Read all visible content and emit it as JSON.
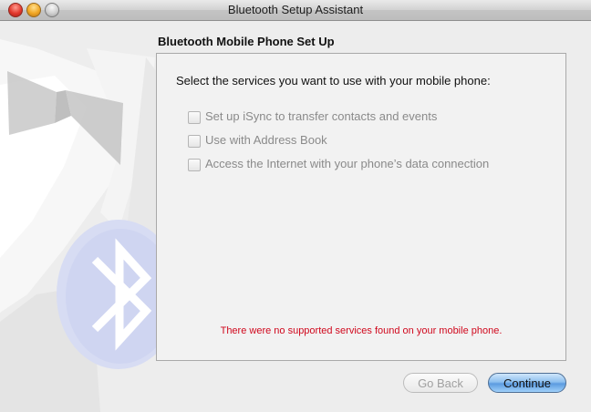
{
  "window": {
    "title": "Bluetooth Setup Assistant"
  },
  "page": {
    "heading": "Bluetooth Mobile Phone Set Up",
    "prompt": "Select the services you want to use with your mobile phone:",
    "options": [
      {
        "label": "Set up iSync to transfer contacts and events",
        "checked": false,
        "enabled": false
      },
      {
        "label": "Use with Address Book",
        "checked": false,
        "enabled": false
      },
      {
        "label": "Access the Internet with your phone’s data connection",
        "checked": false,
        "enabled": false
      }
    ],
    "error_message": "There were no supported services found on your mobile phone."
  },
  "buttons": {
    "back": "Go Back",
    "continue": "Continue"
  },
  "icons": {
    "background_art": "bluetooth-tuxedo-icon"
  },
  "colors": {
    "error": "#d0081d",
    "default_button": "#5c9be0"
  }
}
